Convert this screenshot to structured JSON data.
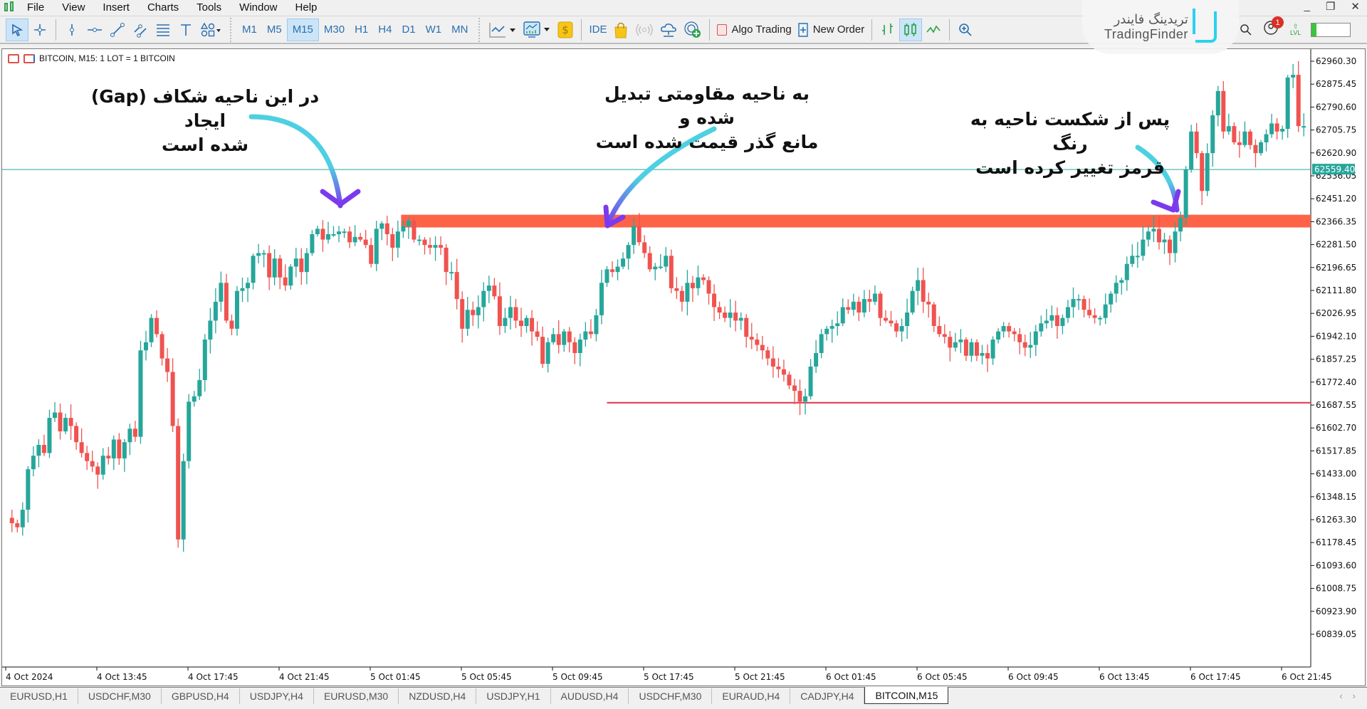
{
  "menu": {
    "items": [
      "File",
      "View",
      "Insert",
      "Charts",
      "Tools",
      "Window",
      "Help"
    ],
    "window_controls": [
      "_",
      "❐",
      "✕"
    ]
  },
  "toolbar": {
    "timeframes": [
      "M1",
      "M5",
      "M15",
      "M30",
      "H1",
      "H4",
      "D1",
      "W1",
      "MN"
    ],
    "active_timeframe": "M15",
    "ide_label": "IDE",
    "algo_trading_label": "Algo Trading",
    "new_order_label": "New Order",
    "notification_count": "1",
    "level_label": "LVL"
  },
  "logo": {
    "fa": "تریدینگ فایندر",
    "en": "TradingFinder"
  },
  "chart": {
    "title": "BITCOIN, M15:  1 LOT = 1 BITCOIN",
    "current_price": "62559.40"
  },
  "annotations": {
    "gap_line1": "در این ناحیه شکاف (Gap) ایجاد",
    "gap_line2": "شده است",
    "resist_line1": "به ناحیه مقاومتی تبدیل شده و",
    "resist_line2": "مانع گذر قیمت شده است",
    "break_line1": "پس از شکست ناحیه به رنگ",
    "break_line2": "قرمز تغییر کرده است"
  },
  "tabs": [
    "EURUSD,H1",
    "USDCHF,M30",
    "GBPUSD,H4",
    "USDJPY,H4",
    "EURUSD,M30",
    "NZDUSD,H4",
    "USDJPY,H1",
    "AUDUSD,H4",
    "USDCHF,M30",
    "EURAUD,H4",
    "CADJPY,H4",
    "BITCOIN,M15"
  ],
  "active_tab": "BITCOIN,M15",
  "colors": {
    "bull": "#26a69a",
    "bear": "#ef5350",
    "zone": "#ff6347",
    "price_line": "#26a69a",
    "low_line": "#e0334a",
    "arrow_start": "#4dd0e1",
    "arrow_end": "#7c3aed"
  },
  "chart_data": {
    "type": "candlestick",
    "symbol": "BITCOIN",
    "timeframe": "M15",
    "y_ticks": [
      "62960.30",
      "62875.45",
      "62790.60",
      "62705.75",
      "62620.90",
      "62536.05",
      "62451.20",
      "62366.35",
      "62281.50",
      "62196.65",
      "62111.80",
      "62026.95",
      "61942.10",
      "61857.25",
      "61772.40",
      "61687.55",
      "61602.70",
      "61517.85",
      "61433.00",
      "61348.15",
      "61263.30",
      "61178.45",
      "61093.60",
      "61008.75",
      "60923.90",
      "60839.05"
    ],
    "ylim": [
      60800,
      63010
    ],
    "x_ticks": [
      "4 Oct 2024",
      "4 Oct 13:45",
      "4 Oct 17:45",
      "4 Oct 21:45",
      "5 Oct 01:45",
      "5 Oct 05:45",
      "5 Oct 09:45",
      "5 Oct 17:45",
      "5 Oct 21:45",
      "6 Oct 01:45",
      "6 Oct 05:45",
      "6 Oct 09:45",
      "6 Oct 13:45",
      "6 Oct 17:45",
      "6 Oct 21:45"
    ],
    "current_price": 62559.4,
    "gap_zone": {
      "low": 62345,
      "high": 62392,
      "from_bar": 73
    },
    "support_line": {
      "price": 61696,
      "from_bar": 111
    },
    "closes": [
      61250,
      61235,
      61300,
      61450,
      61500,
      61540,
      61510,
      61640,
      61660,
      61590,
      61640,
      61610,
      61550,
      61510,
      61480,
      61460,
      61430,
      61500,
      61490,
      61560,
      61490,
      61550,
      61600,
      61570,
      61890,
      61920,
      62010,
      61950,
      61860,
      61810,
      61610,
      61190,
      61480,
      61700,
      61720,
      61780,
      61930,
      62000,
      62070,
      62140,
      62000,
      61970,
      62110,
      62120,
      62140,
      62240,
      62250,
      62250,
      62160,
      62230,
      62160,
      62130,
      62200,
      62230,
      62180,
      62250,
      62320,
      62340,
      62300,
      62320,
      62320,
      62330,
      62330,
      62290,
      62310,
      62300,
      62280,
      62210,
      62340,
      62360,
      62320,
      62270,
      62330,
      62350,
      62370,
      62300,
      62300,
      62280,
      62270,
      62280,
      62270,
      62180,
      62180,
      62080,
      61970,
      62040,
      62020,
      62050,
      62110,
      62130,
      62090,
      61980,
      62010,
      62050,
      62000,
      61980,
      62010,
      61960,
      61940,
      61840,
      61920,
      61950,
      61910,
      61960,
      61920,
      61880,
      61930,
      61960,
      61950,
      62020,
      62140,
      62190,
      62180,
      62200,
      62230,
      62280,
      62350,
      62290,
      62250,
      62190,
      62200,
      62200,
      62240,
      62120,
      62110,
      62070,
      62140,
      62120,
      62160,
      62150,
      62100,
      62050,
      62030,
      62010,
      62030,
      62000,
      62010,
      61940,
      61930,
      61910,
      61890,
      61860,
      61830,
      61820,
      61800,
      61760,
      61740,
      61700,
      61720,
      61830,
      61880,
      61950,
      61970,
      61980,
      61990,
      62050,
      62040,
      62070,
      62030,
      62080,
      62070,
      62100,
      62010,
      62000,
      61990,
      61960,
      61980,
      62030,
      62110,
      62150,
      62070,
      62060,
      61980,
      61950,
      61940,
      61900,
      61920,
      61930,
      61870,
      61920,
      61870,
      61880,
      61860,
      61930,
      61960,
      61980,
      61960,
      61950,
      61920,
      61900,
      61910,
      61960,
      61990,
      62000,
      62020,
      61980,
      62010,
      62050,
      62080,
      62080,
      62040,
      62020,
      62010,
      62010,
      62060,
      62100,
      62140,
      62150,
      62210,
      62240,
      62240,
      62300,
      62330,
      62340,
      62290,
      62300,
      62250,
      62330,
      62380,
      62560,
      62700,
      62620,
      62480,
      62620,
      62760,
      62850,
      62700,
      62720,
      62660,
      62650,
      62700,
      62650,
      62620,
      62660,
      62690,
      62730,
      62700,
      62710,
      62900,
      62910,
      62720,
      62720
    ]
  }
}
